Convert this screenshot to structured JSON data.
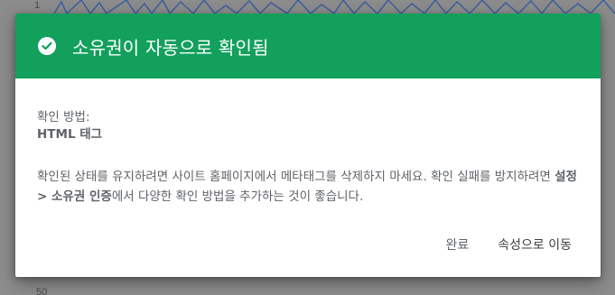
{
  "background": {
    "y_tick_top": "1",
    "y_tick_bottom": "50"
  },
  "dialog": {
    "title": "소유권이 자동으로 확인됨",
    "title_icon": "check-circle-icon",
    "header_color": "#12a05c",
    "method_label": "확인 방법:",
    "method_value": "HTML 태그",
    "desc_part1": "확인된 상태를 유지하려면 사이트 홈페이지에서 메타태그를 삭제하지 마세요. 확인 실패를 방지하려면 ",
    "desc_bold": "설정 > 소유권 인증",
    "desc_part2": "에서 다양한 확인 방법을 추가하는 것이 좋습니다.",
    "done_button": "완료",
    "go_to_property_button": "속성으로 이동"
  }
}
